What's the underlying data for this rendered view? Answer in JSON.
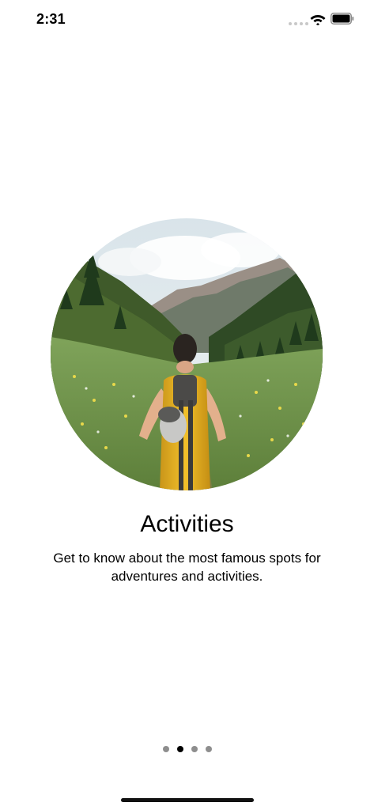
{
  "status_bar": {
    "time": "2:31"
  },
  "onboarding": {
    "title": "Activities",
    "description": "Get to know about the most famous spots for adventures and activities.",
    "hero_image_subject": "hiker-in-mountain-meadow",
    "page_count": 4,
    "active_page_index": 1
  },
  "colors": {
    "background": "#ffffff",
    "text": "#000000",
    "page_dot_inactive": "#8e8e8e",
    "page_dot_active": "#000000"
  }
}
